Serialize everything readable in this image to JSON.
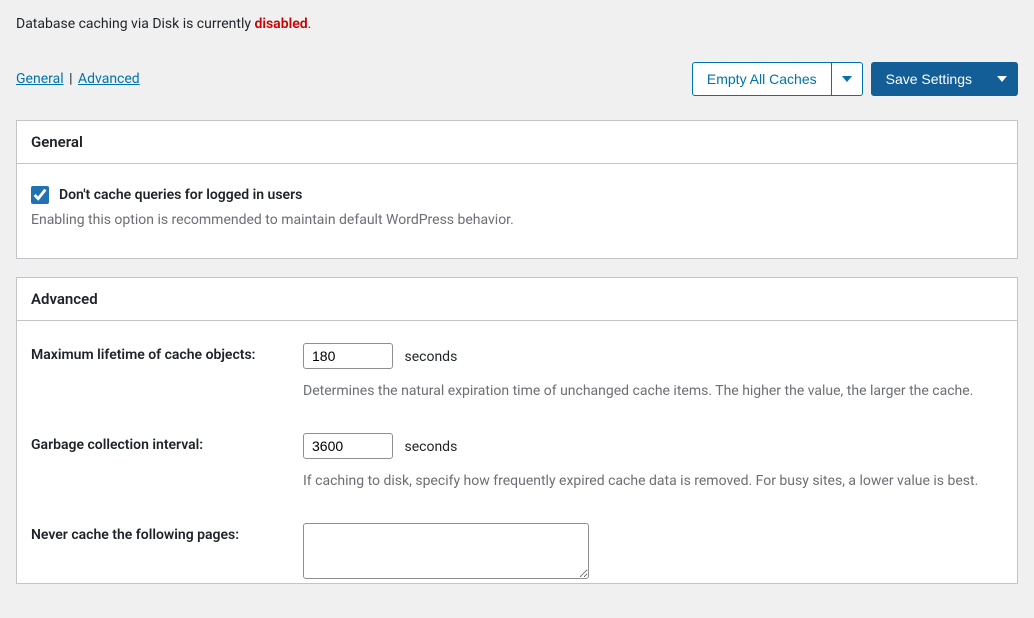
{
  "status": {
    "prefix": "Database caching via Disk is currently ",
    "state": "disabled",
    "suffix": "."
  },
  "breadcrumb": {
    "general": "General",
    "advanced": "Advanced"
  },
  "actions": {
    "empty_caches": "Empty All Caches",
    "save_settings": "Save Settings"
  },
  "general_panel": {
    "title": "General",
    "checkbox_label": "Don't cache queries for logged in users",
    "help": "Enabling this option is recommended to maintain default WordPress behavior."
  },
  "advanced_panel": {
    "title": "Advanced",
    "max_lifetime": {
      "label": "Maximum lifetime of cache objects:",
      "value": "180",
      "unit": "seconds",
      "desc": "Determines the natural expiration time of unchanged cache items. The higher the value, the larger the cache."
    },
    "gc_interval": {
      "label": "Garbage collection interval:",
      "value": "3600",
      "unit": "seconds",
      "desc": "If caching to disk, specify how frequently expired cache data is removed. For busy sites, a lower value is best."
    },
    "never_cache": {
      "label": "Never cache the following pages:",
      "value": ""
    }
  }
}
